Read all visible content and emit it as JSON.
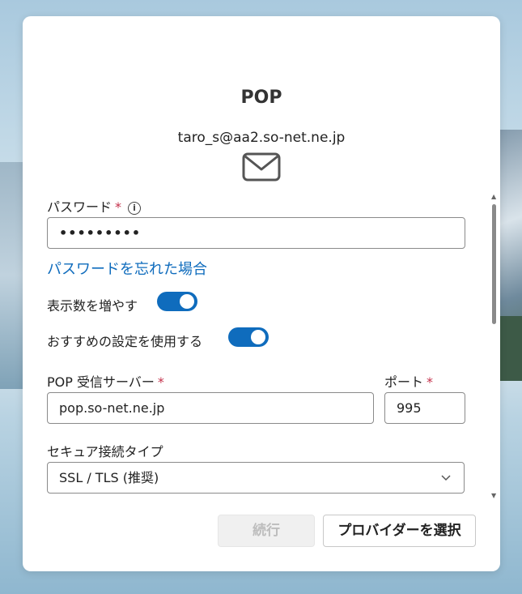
{
  "dialog": {
    "title": "POP",
    "email": "taro_s@aa2.so-net.ne.jp"
  },
  "password": {
    "label": "パスワード",
    "required_mark": "*",
    "info_glyph": "i",
    "value": "•••••••••",
    "forgot_link": "パスワードを忘れた場合"
  },
  "toggles": [
    {
      "label": "表示数を増やす",
      "on": true
    },
    {
      "label": "おすすめの設定を使用する",
      "on": true
    }
  ],
  "pop_server": {
    "label": "POP 受信サーバー",
    "required_mark": "*",
    "value": "pop.so-net.ne.jp"
  },
  "port": {
    "label": "ポート",
    "required_mark": "*",
    "value": "995"
  },
  "secure_connection": {
    "label": "セキュア接続タイプ",
    "selected": "SSL / TLS (推奨)"
  },
  "scrollbar": {
    "up_glyph": "▲",
    "down_glyph": "▼"
  },
  "buttons": {
    "continue_label": "続行",
    "choose_provider_label": "プロバイダーを選択"
  },
  "colors": {
    "accent": "#0f6cbd",
    "required": "#c4314b",
    "disabled_bg": "#f0f0f0",
    "disabled_text": "#bdbdbd"
  },
  "icons": {
    "mail": "envelope-icon",
    "info": "info-icon",
    "dropdown": "chevron-down-icon"
  }
}
